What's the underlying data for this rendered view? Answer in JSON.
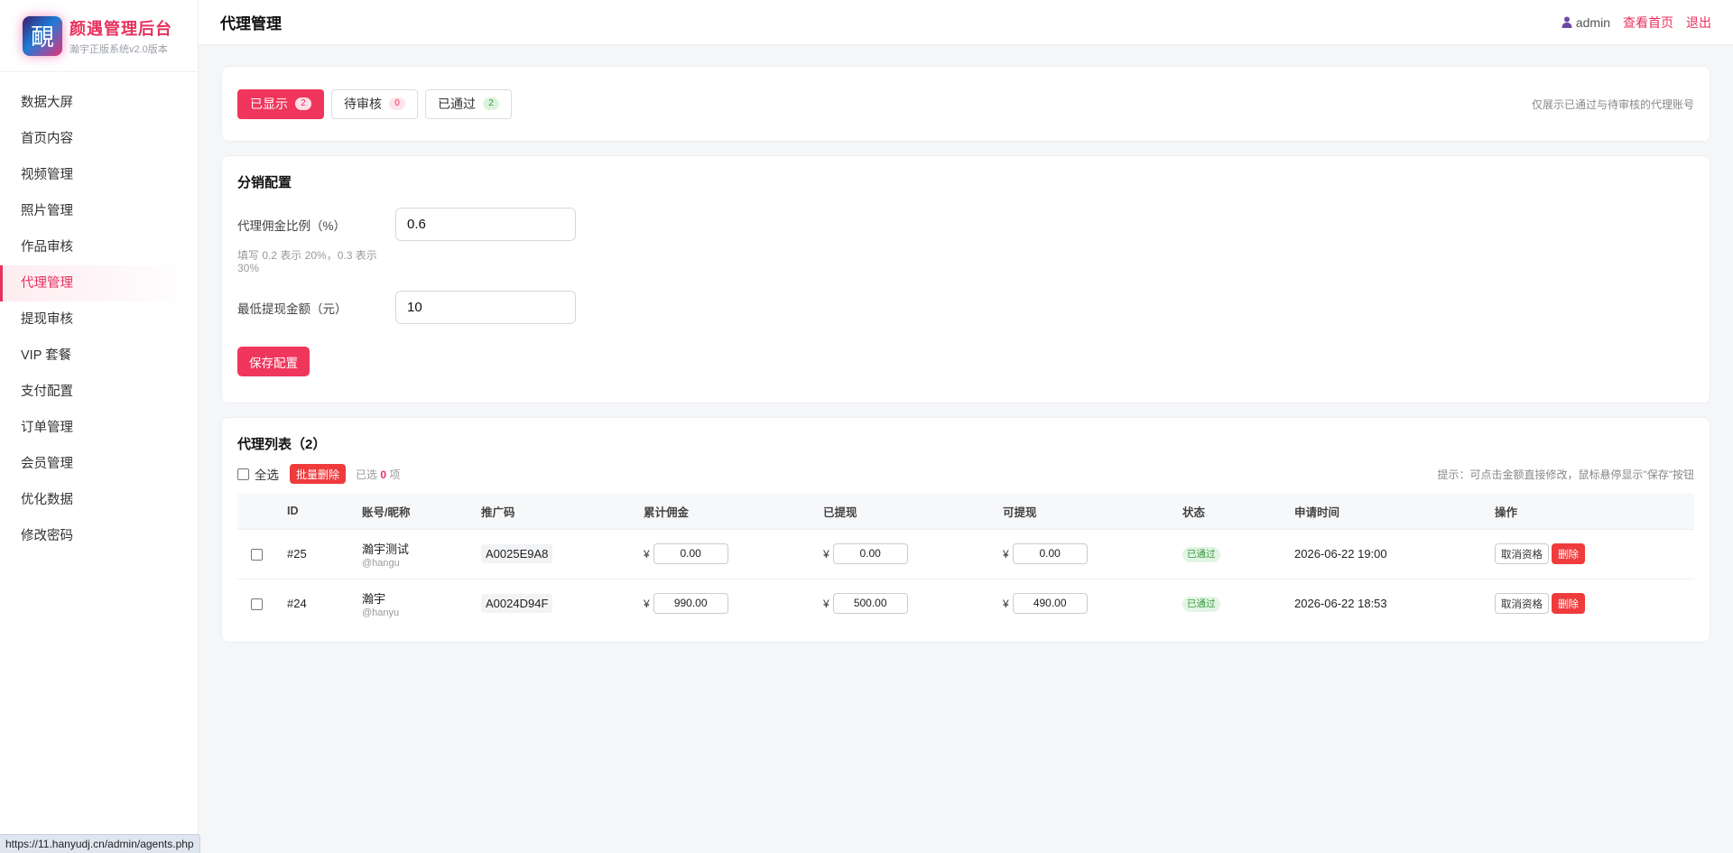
{
  "brand": {
    "logo_char": "靦",
    "title": "颜遇管理后台",
    "subtitle": "瀚宇正版系统v2.0版本"
  },
  "sidebar": {
    "items": [
      {
        "label": "数据大屏",
        "active": false
      },
      {
        "label": "首页内容",
        "active": false
      },
      {
        "label": "视频管理",
        "active": false
      },
      {
        "label": "照片管理",
        "active": false
      },
      {
        "label": "作品审核",
        "active": false
      },
      {
        "label": "代理管理",
        "active": true
      },
      {
        "label": "提现审核",
        "active": false
      },
      {
        "label": "VIP 套餐",
        "active": false
      },
      {
        "label": "支付配置",
        "active": false
      },
      {
        "label": "订单管理",
        "active": false
      },
      {
        "label": "会员管理",
        "active": false
      },
      {
        "label": "优化数据",
        "active": false
      },
      {
        "label": "修改密码",
        "active": false
      }
    ]
  },
  "header": {
    "title": "代理管理",
    "user": "admin",
    "home_link": "查看首页",
    "logout": "退出",
    "user_icon": "user-icon"
  },
  "tabs": {
    "items": [
      {
        "label": "已显示",
        "count": "2",
        "active": true
      },
      {
        "label": "待审核",
        "count": "0",
        "active": false
      },
      {
        "label": "已通过",
        "count": "2",
        "active": false
      }
    ],
    "note": "仅展示已通过与待审核的代理账号"
  },
  "config": {
    "title": "分销配置",
    "commission_label": "代理佣金比例（%）",
    "commission_value": "0.6",
    "commission_hint": "填写 0.2 表示 20%，0.3 表示 30%",
    "min_withdraw_label": "最低提现金额（元）",
    "min_withdraw_value": "10",
    "save_button": "保存配置"
  },
  "list": {
    "title": "代理列表（2）",
    "select_all": "全选",
    "batch_delete": "批量删除",
    "selected_prefix": "已选",
    "selected_count": "0",
    "selected_suffix": "项",
    "tip": "提示：可点击金额直接修改，鼠标悬停显示\"保存\"按钮",
    "columns": [
      "ID",
      "账号/昵称",
      "推广码",
      "累计佣金",
      "已提现",
      "可提现",
      "状态",
      "申请时间",
      "操作"
    ],
    "currency": "¥",
    "rows": [
      {
        "id": "#25",
        "name": "瀚宇测试",
        "account": "@hangu",
        "code": "A0025E9A8",
        "total": "0.00",
        "withdrawn": "0.00",
        "available": "0.00",
        "status": "已通过",
        "time": "2026-06-22 19:00",
        "cancel": "取消资格",
        "delete": "删除"
      },
      {
        "id": "#24",
        "name": "瀚宇",
        "account": "@hanyu",
        "code": "A0024D94F",
        "total": "990.00",
        "withdrawn": "500.00",
        "available": "490.00",
        "status": "已通过",
        "time": "2026-06-22 18:53",
        "cancel": "取消资格",
        "delete": "删除"
      }
    ]
  },
  "statusbar": {
    "url": "https://11.hanyudj.cn/admin/agents.php"
  },
  "colors": {
    "accent": "#f0365c",
    "danger": "#ef3b3b",
    "success": "#3a9a42"
  }
}
